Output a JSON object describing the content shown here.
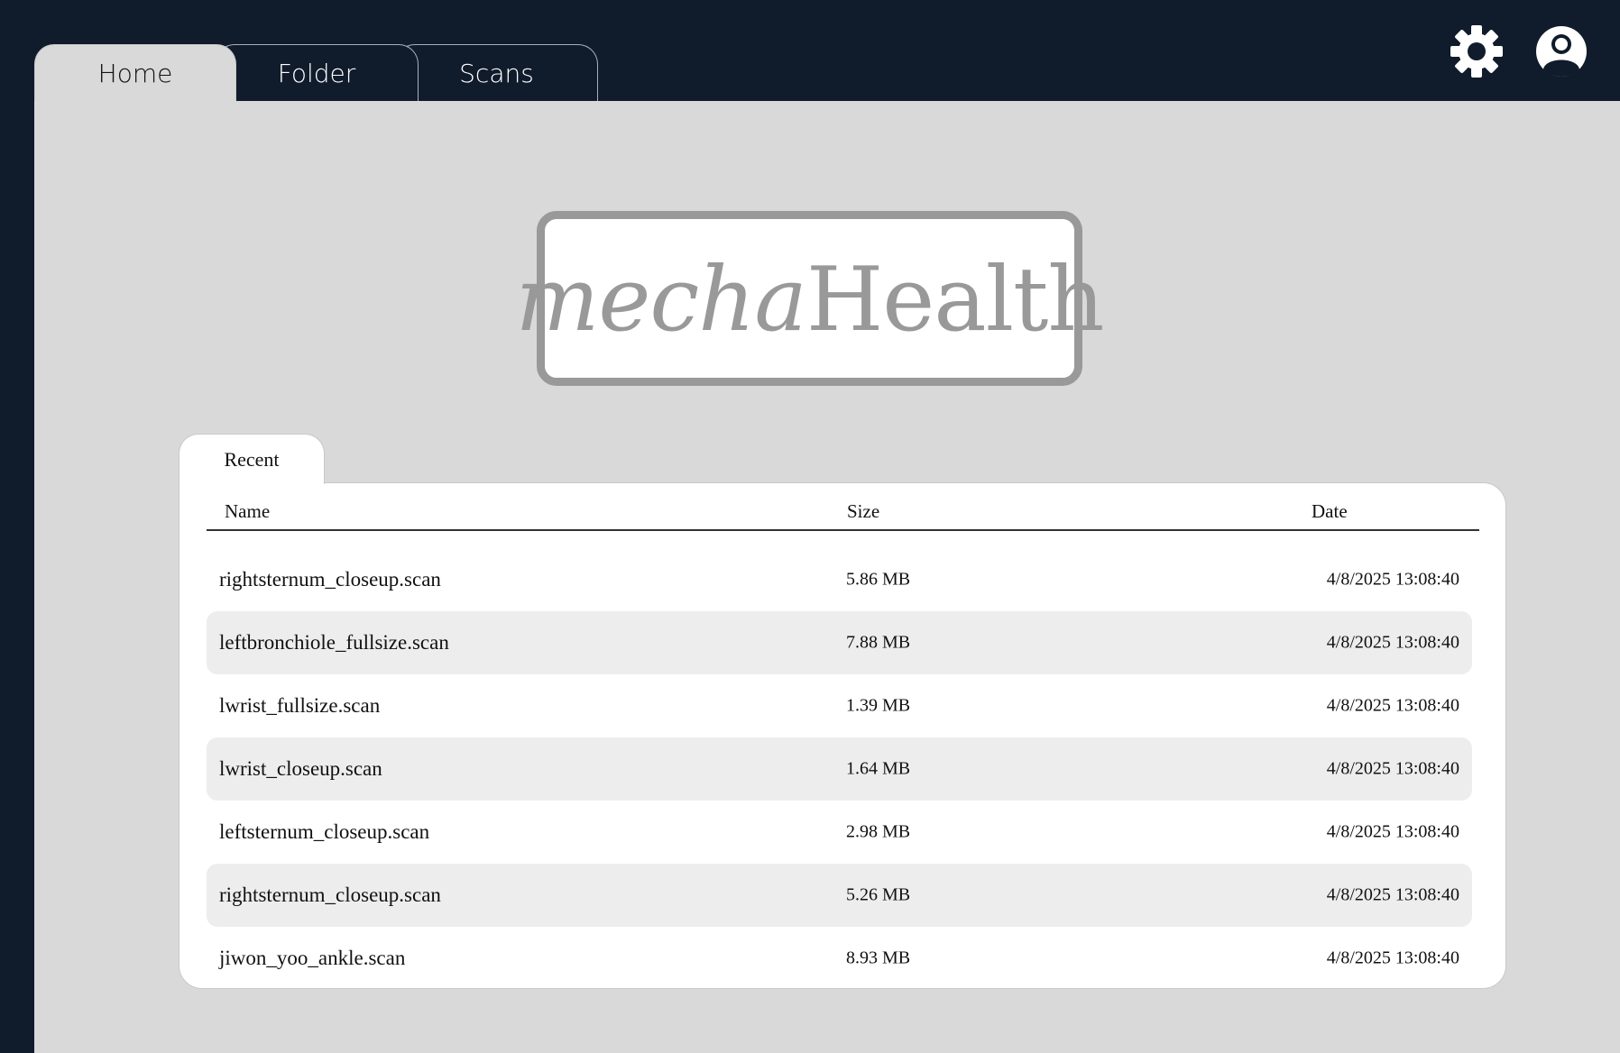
{
  "nav": {
    "tabs": [
      {
        "label": "Home",
        "active": true
      },
      {
        "label": "Folder",
        "active": false
      },
      {
        "label": "Scans",
        "active": false
      }
    ]
  },
  "header_icons": [
    "gear-icon",
    "user-avatar-icon"
  ],
  "logo": {
    "part_italic": "mecha",
    "part_regular": "Health"
  },
  "recent": {
    "tab_label": "Recent",
    "columns": {
      "name": "Name",
      "size": "Size",
      "date": "Date"
    },
    "rows": [
      {
        "name": "rightsternum_closeup.scan",
        "size": "5.86 MB",
        "date": "4/8/2025 13:08:40"
      },
      {
        "name": "leftbronchiole_fullsize.scan",
        "size": "7.88 MB",
        "date": "4/8/2025 13:08:40"
      },
      {
        "name": "lwrist_fullsize.scan",
        "size": "1.39 MB",
        "date": "4/8/2025 13:08:40"
      },
      {
        "name": "lwrist_closeup.scan",
        "size": "1.64 MB",
        "date": "4/8/2025 13:08:40"
      },
      {
        "name": "leftsternum_closeup.scan",
        "size": "2.98 MB",
        "date": "4/8/2025 13:08:40"
      },
      {
        "name": "rightsternum_closeup.scan",
        "size": "5.26 MB",
        "date": "4/8/2025 13:08:40"
      },
      {
        "name": "jiwon_yoo_ankle.scan",
        "size": "8.93 MB",
        "date": "4/8/2025 13:08:40"
      }
    ]
  },
  "colors": {
    "chrome": "#101b2b",
    "panel": "#d9d9d9",
    "logo_gray": "#999999",
    "row_shade": "#ededed"
  }
}
